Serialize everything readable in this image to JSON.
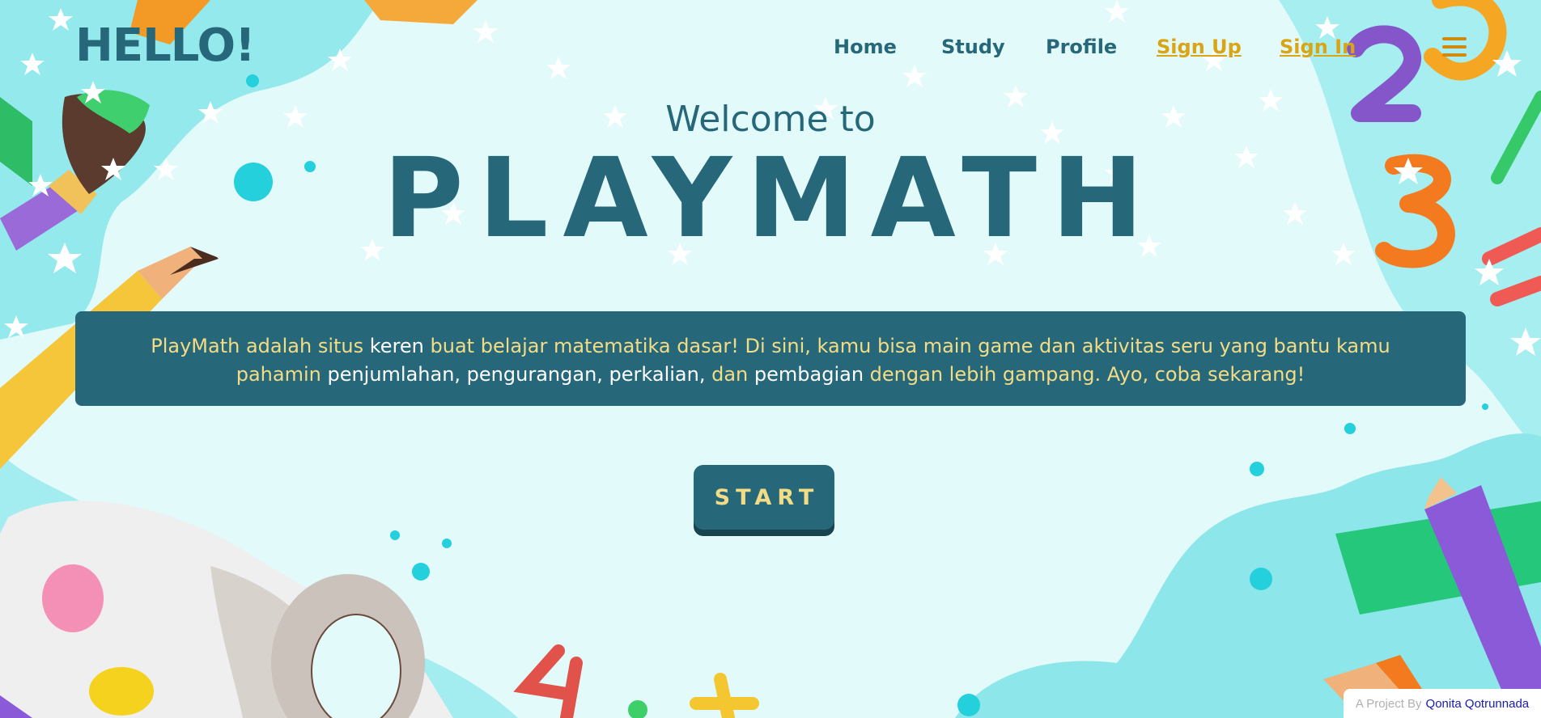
{
  "header": {
    "logo": "HELLO!",
    "nav": [
      {
        "label": "Home"
      },
      {
        "label": "Study"
      },
      {
        "label": "Profile"
      },
      {
        "label": "Sign Up"
      },
      {
        "label": "Sign In"
      }
    ],
    "menu_icon": "hamburger-menu-icon"
  },
  "hero": {
    "welcome": "Welcome to",
    "brand": "PLAYMATH",
    "description": {
      "part1": "PlayMath adalah situs ",
      "part2": "keren",
      "part3": " buat belajar matematika dasar! Di sini, kamu bisa main game dan aktivitas seru yang bantu kamu pahamin ",
      "part4": "penjumlahan, pengurangan, perkalian,",
      "part5": " dan ",
      "part6": "pembagian",
      "part7": " dengan lebih gampang. Ayo, coba sekarang!"
    },
    "start_label": "START"
  },
  "footer": {
    "credit_prefix": "A Project By",
    "credit_author": "Qonita Qotrunnada"
  },
  "colors": {
    "primary": "#27677a",
    "accent_yellow": "#f3dc86",
    "link_gold": "#d9a514",
    "background": "#d9f7f9"
  }
}
